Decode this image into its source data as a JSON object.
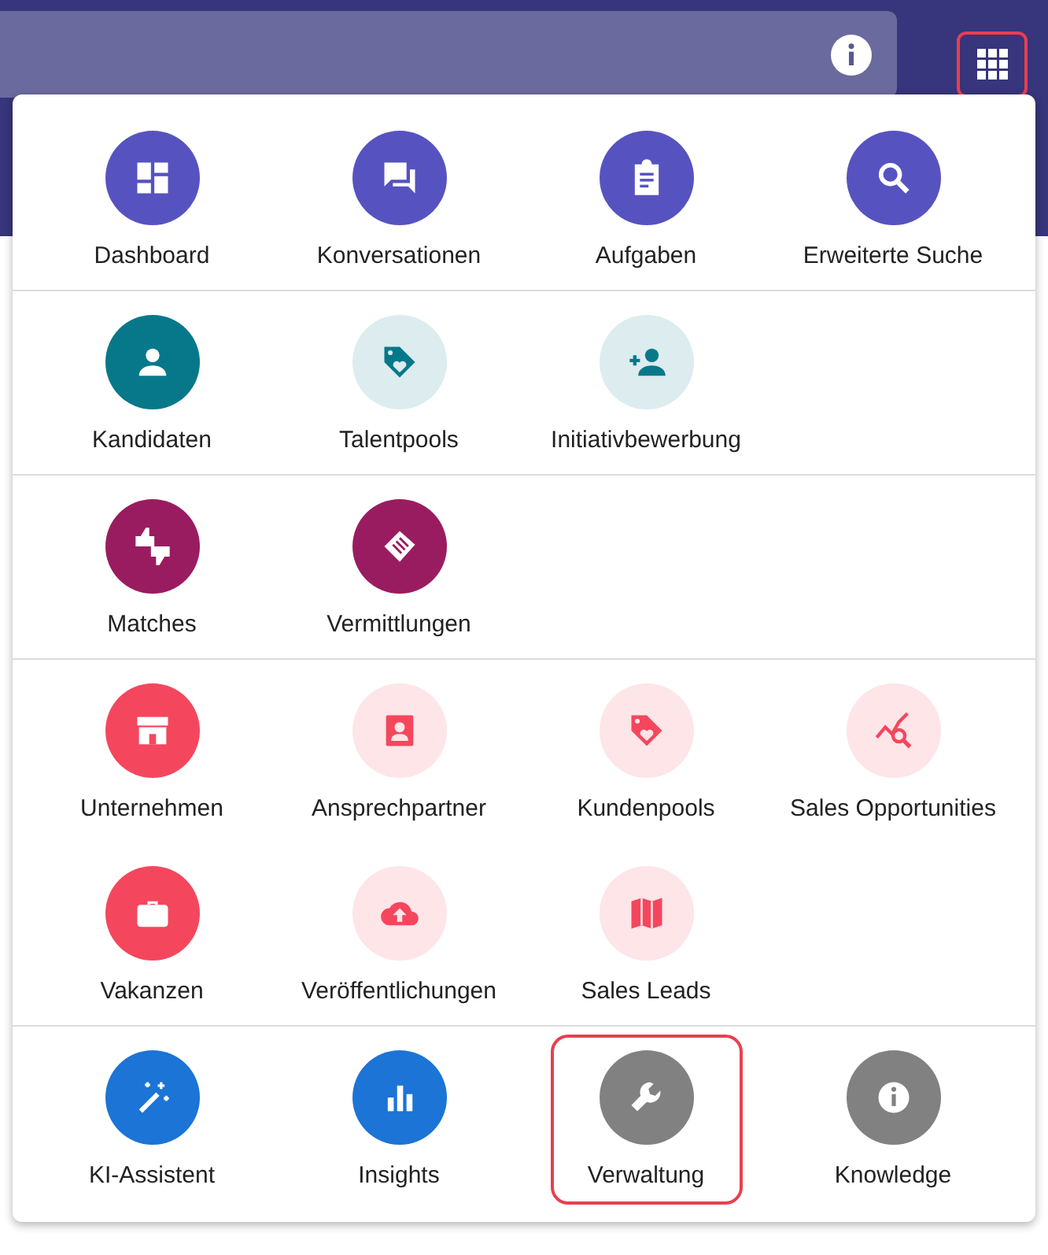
{
  "header": {
    "apps_button": {
      "highlighted": true
    }
  },
  "menu": {
    "sections": [
      {
        "items": [
          {
            "label": "Dashboard",
            "color": "#5653c0",
            "tint": false,
            "highlighted": false
          },
          {
            "label": "Konversationen",
            "color": "#5653c0",
            "tint": false,
            "highlighted": false
          },
          {
            "label": "Aufgaben",
            "color": "#5653c0",
            "tint": false,
            "highlighted": false
          },
          {
            "label": "Erweiterte Suche",
            "color": "#5653c0",
            "tint": false,
            "highlighted": false
          }
        ]
      },
      {
        "items": [
          {
            "label": "Kandidaten",
            "color": "#07788a",
            "tint": false,
            "highlighted": false
          },
          {
            "label": "Talentpools",
            "color": "#07788a",
            "tint": true,
            "highlighted": false
          },
          {
            "label": "Initiativbewerbung",
            "color": "#07788a",
            "tint": true,
            "highlighted": false
          }
        ]
      },
      {
        "items": [
          {
            "label": "Matches",
            "color": "#9a1c60",
            "tint": false,
            "highlighted": false
          },
          {
            "label": "Vermittlungen",
            "color": "#9a1c60",
            "tint": false,
            "highlighted": false
          }
        ]
      },
      {
        "items": [
          {
            "label": "Unternehmen",
            "color": "#f4475d",
            "tint": false,
            "highlighted": false
          },
          {
            "label": "Ansprechpartner",
            "color": "#f4475d",
            "tint": true,
            "highlighted": false
          },
          {
            "label": "Kundenpools",
            "color": "#f4475d",
            "tint": true,
            "highlighted": false
          },
          {
            "label": "Sales Opportunities",
            "color": "#f4475d",
            "tint": true,
            "highlighted": false
          },
          {
            "label": "Vakanzen",
            "color": "#f4475d",
            "tint": false,
            "highlighted": false
          },
          {
            "label": "Veröffentlichungen",
            "color": "#f4475d",
            "tint": true,
            "highlighted": false
          },
          {
            "label": "Sales Leads",
            "color": "#f4475d",
            "tint": true,
            "highlighted": false
          }
        ]
      },
      {
        "items": [
          {
            "label": "KI-Assistent",
            "color": "#1b74d6",
            "tint": false,
            "highlighted": false
          },
          {
            "label": "Insights",
            "color": "#1b74d6",
            "tint": false,
            "highlighted": false
          },
          {
            "label": "Verwaltung",
            "color": "#818181",
            "tint": false,
            "highlighted": true
          },
          {
            "label": "Knowledge",
            "color": "#818181",
            "tint": false,
            "highlighted": false
          }
        ]
      }
    ]
  }
}
